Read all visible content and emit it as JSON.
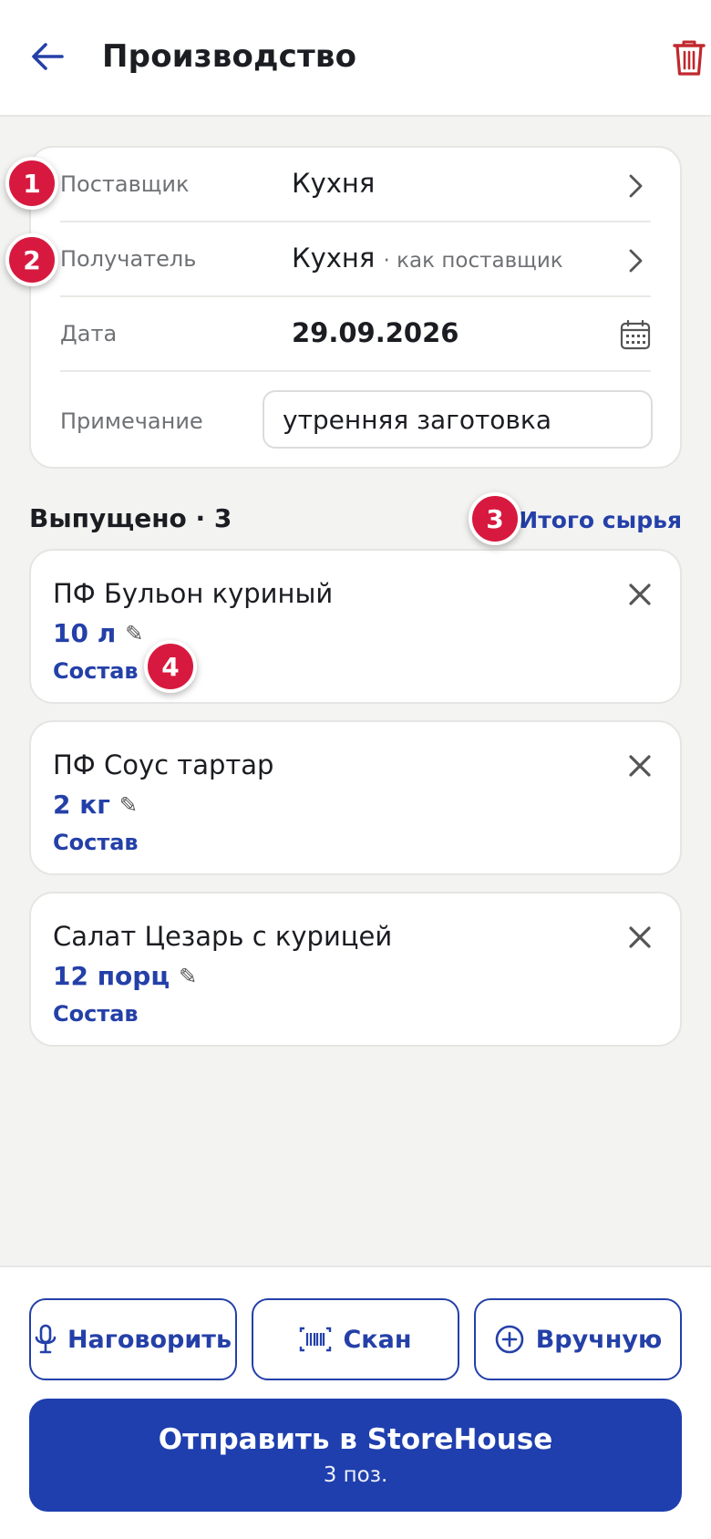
{
  "header": {
    "title": "Производство",
    "back_icon": "arrow-left-icon",
    "delete_icon": "trash-icon"
  },
  "form": {
    "supplier": {
      "label": "Поставщик",
      "value": "Кухня"
    },
    "receiver": {
      "label": "Получатель",
      "value": "Кухня",
      "note": "· как поставщик"
    },
    "date": {
      "label": "Дата",
      "value": "29.09.2026",
      "icon": "calendar-icon"
    },
    "remark": {
      "label": "Примечание",
      "value": "утренняя заготовка"
    }
  },
  "produced": {
    "title": "Выпущено · 3",
    "totals_link": "Итого сырья",
    "items": [
      {
        "name": "ПФ Бульон куриный",
        "qty": "10 л",
        "composition": "Состав"
      },
      {
        "name": "ПФ Соус тартар",
        "qty": "2 кг",
        "composition": "Состав"
      },
      {
        "name": "Салат Цезарь с курицей",
        "qty": "12 порц",
        "composition": "Состав"
      }
    ]
  },
  "badges": [
    "1",
    "2",
    "3",
    "4"
  ],
  "actions": {
    "voice": "Наговорить",
    "scan": "Скан",
    "manual": "Вручную"
  },
  "submit": {
    "label": "Отправить в StoreHouse",
    "count": "3 поз."
  },
  "colors": {
    "accent": "#1f3fae",
    "link": "#2440a8",
    "badge": "#d8193f",
    "danger": "#c0282d"
  }
}
